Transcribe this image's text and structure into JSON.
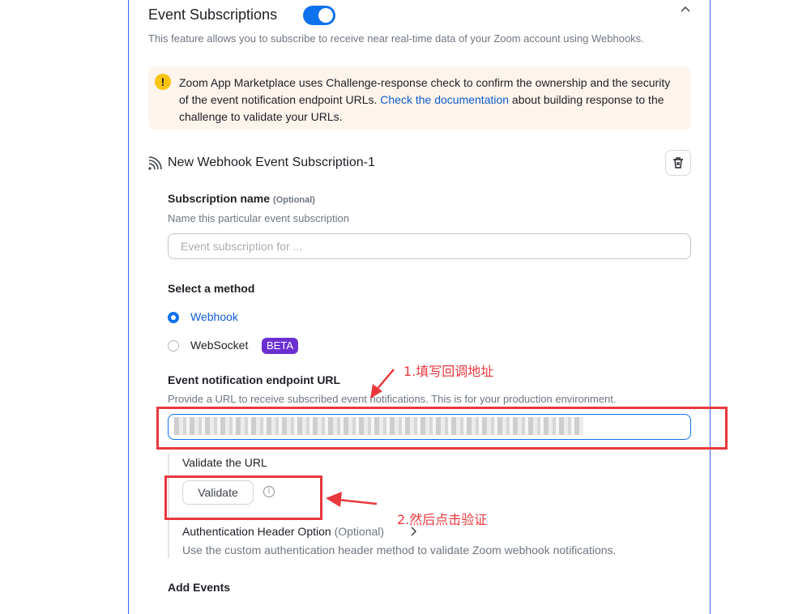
{
  "section": {
    "title": "Event Subscriptions",
    "toggle_on": true,
    "description": "This feature allows you to subscribe to receive near real-time data of your Zoom account using Webhooks."
  },
  "alert": {
    "text_before": "Zoom App Marketplace uses Challenge-response check to confirm the ownership and the security of the event notification endpoint URLs. ",
    "link": "Check the documentation",
    "text_after": " about building response to the challenge to validate your URLs."
  },
  "subscription": {
    "title": "New Webhook Event Subscription-1",
    "name_label": "Subscription name",
    "name_optional": "(Optional)",
    "name_help": "Name this particular event subscription",
    "name_placeholder": "Event subscription for ...",
    "method_label": "Select a method",
    "methods": [
      {
        "label": "Webhook",
        "selected": true
      },
      {
        "label": "WebSocket",
        "selected": false,
        "badge": "BETA"
      }
    ],
    "endpoint_label": "Event notification endpoint URL",
    "endpoint_help": "Provide a URL to receive subscribed event notifications. This is for your production environment.",
    "validate_label": "Validate the URL",
    "validate_button": "Validate",
    "auth_label": "Authentication Header Option",
    "auth_optional": "(Optional)",
    "auth_help": "Use the custom authentication header method to validate Zoom webhook notifications.",
    "add_events_label": "Add Events"
  },
  "annotations": {
    "note1": "1.填写回调地址",
    "note2": "2.然后点击验证"
  },
  "colors": {
    "accent": "#0e72ed",
    "annotation_red": "#e8383d",
    "beta_purple": "#6b2fd1",
    "alert_bg": "#fdf4ec"
  }
}
